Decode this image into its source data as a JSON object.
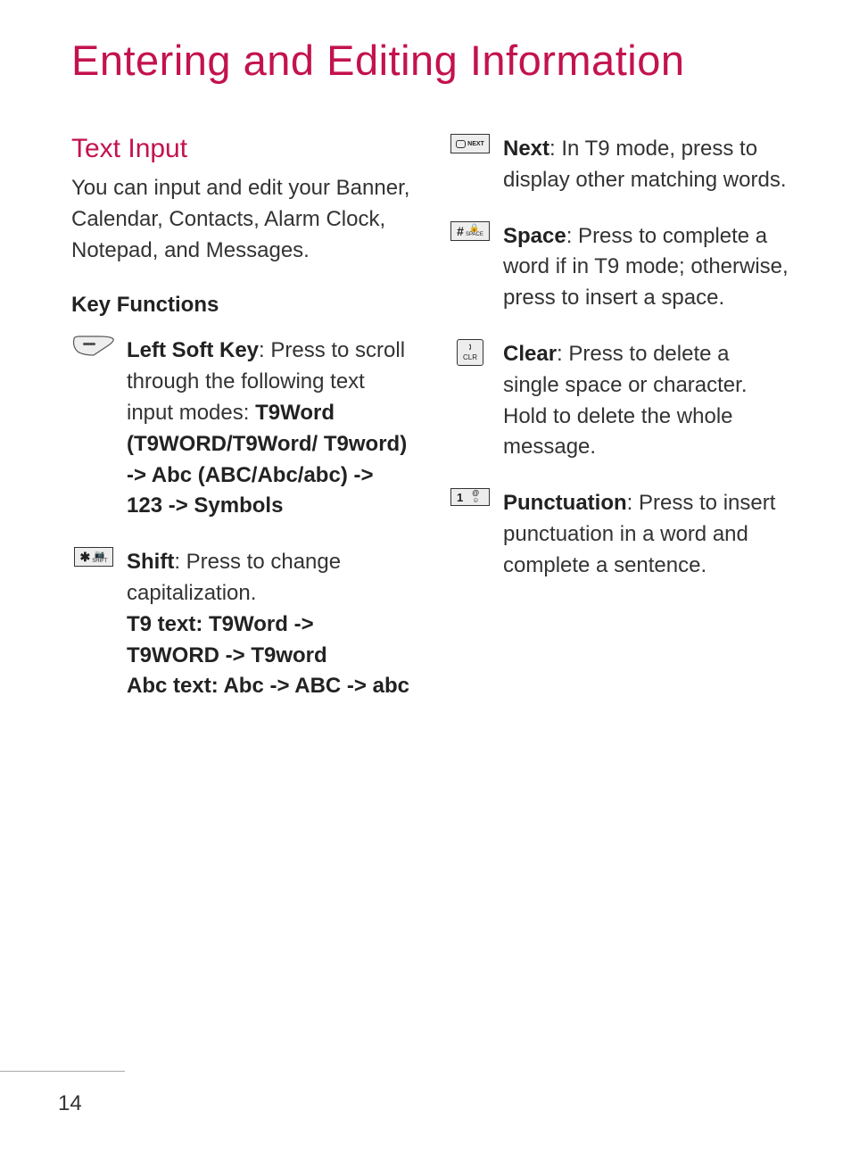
{
  "title": "Entering and Editing Information",
  "section": "Text Input",
  "intro": "You can input and edit your Banner, Calendar, Contacts, Alarm Clock, Notepad, and Messages.",
  "subheading": "Key Functions",
  "keys": {
    "left_soft": {
      "label": "Left Soft Key",
      "body": ": Press to scroll through the following text input modes: ",
      "modes": "T9Word (T9WORD/T9Word/ T9word) -> Abc (ABC/Abc/abc) -> 123 -> Symbols"
    },
    "shift": {
      "icon_main": "✱",
      "icon_sub": "SHIFT",
      "label": "Shift",
      "body": ": Press to change capitalization.",
      "line2": "T9 text: T9Word -> T9WORD -> T9word",
      "line3": "Abc text: Abc -> ABC -> abc"
    },
    "next": {
      "icon_main": "◯",
      "icon_sub": "NEXT",
      "label": "Next",
      "body": ": In T9 mode, press to display other matching words."
    },
    "space": {
      "icon_main": "#",
      "icon_sub": "SPACE",
      "label": "Space",
      "body": ": Press to complete a word if in T9 mode; otherwise, press to insert a space."
    },
    "clear": {
      "icon_line1": "🕽",
      "icon_line2": "CLR",
      "label": "Clear",
      "body": ": Press to delete a single space or character. Hold to delete the whole message."
    },
    "punct": {
      "icon_main": "1",
      "label": "Punctuation",
      "body": ": Press to insert punctuation in a word and complete a sentence."
    }
  },
  "page_number": "14"
}
